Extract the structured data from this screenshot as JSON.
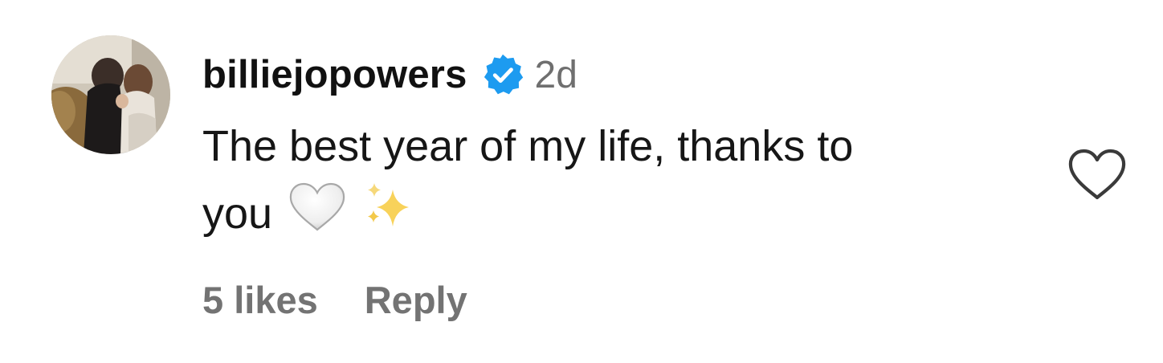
{
  "comment": {
    "username": "billiejopowers",
    "verified_icon": "verified-badge-icon",
    "timestamp": "2d",
    "text_line1": "The best year of my life, thanks to",
    "text_line2": "you",
    "emojis": [
      "white-heart-emoji",
      "sparkles-emoji"
    ],
    "likes": "5 likes",
    "reply_label": "Reply",
    "like_icon": "heart-outline-icon"
  },
  "colors": {
    "username": "#111111",
    "text": "#161616",
    "muted": "#737373",
    "verified_blue": "#1d9bf0"
  }
}
